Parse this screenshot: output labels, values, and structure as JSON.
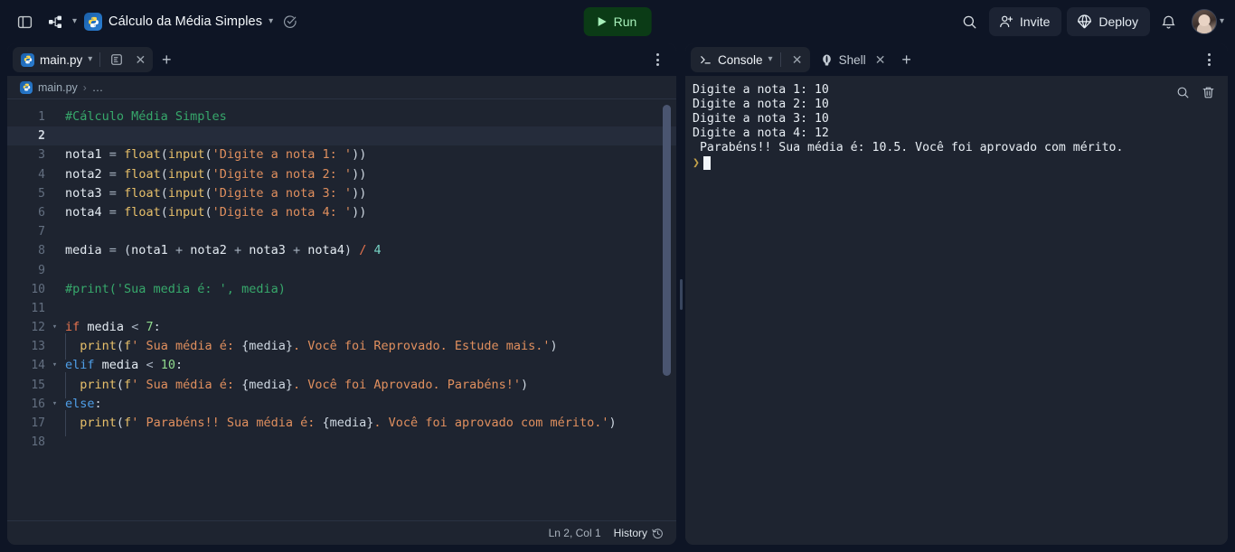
{
  "header": {
    "sidebar_toggle_icon": "panel-left-icon",
    "workflow_icon": "git-branch-icon",
    "project_icon": "python-logo-icon",
    "project_title": "Cálculo da Média Simples",
    "project_chevron": "chevron-down-icon",
    "check_icon": "circle-check-icon",
    "run_label": "Run",
    "run_icon": "play-icon",
    "search_icon": "search-icon",
    "invite_label": "Invite",
    "invite_icon": "user-plus-icon",
    "deploy_label": "Deploy",
    "deploy_icon": "parachute-icon",
    "bell_icon": "bell-icon",
    "avatar_icon": "user-avatar",
    "avatar_chevron": "chevron-down-icon"
  },
  "editor": {
    "tab_label": "main.py",
    "tab_icon": "python-logo-icon",
    "tab_chevron": "chevron-down-icon",
    "preview_icon": "document-pane-icon",
    "close_icon": "close-icon",
    "add_tab_icon": "plus-icon",
    "kebab_icon": "more-options-icon",
    "breadcrumb_file": "main.py",
    "breadcrumb_sep": "›",
    "breadcrumb_tail": "…",
    "status": {
      "cursor_position": "Ln 2, Col 1",
      "history_label": "History",
      "history_icon": "history-clock-icon"
    },
    "lines": [
      {
        "n": "1",
        "fold": "",
        "tokens": [
          {
            "t": "#Cálculo Média Simples",
            "c": "tk-com"
          }
        ]
      },
      {
        "n": "2",
        "fold": "",
        "highlight": true,
        "tokens": []
      },
      {
        "n": "3",
        "fold": "",
        "tokens": [
          {
            "t": "nota1",
            "c": "tk-id"
          },
          {
            "t": " ",
            "c": "tk-op"
          },
          {
            "t": "=",
            "c": "tk-op"
          },
          {
            "t": " ",
            "c": "tk-op"
          },
          {
            "t": "float",
            "c": "tk-fn"
          },
          {
            "t": "(",
            "c": "tk-br"
          },
          {
            "t": "input",
            "c": "tk-fn"
          },
          {
            "t": "(",
            "c": "tk-br"
          },
          {
            "t": "'Digite a nota 1: '",
            "c": "tk-str"
          },
          {
            "t": "))",
            "c": "tk-br"
          }
        ]
      },
      {
        "n": "4",
        "fold": "",
        "tokens": [
          {
            "t": "nota2",
            "c": "tk-id"
          },
          {
            "t": " ",
            "c": "tk-op"
          },
          {
            "t": "=",
            "c": "tk-op"
          },
          {
            "t": " ",
            "c": "tk-op"
          },
          {
            "t": "float",
            "c": "tk-fn"
          },
          {
            "t": "(",
            "c": "tk-br"
          },
          {
            "t": "input",
            "c": "tk-fn"
          },
          {
            "t": "(",
            "c": "tk-br"
          },
          {
            "t": "'Digite a nota 2: '",
            "c": "tk-str"
          },
          {
            "t": "))",
            "c": "tk-br"
          }
        ]
      },
      {
        "n": "5",
        "fold": "",
        "tokens": [
          {
            "t": "nota3",
            "c": "tk-id"
          },
          {
            "t": " ",
            "c": "tk-op"
          },
          {
            "t": "=",
            "c": "tk-op"
          },
          {
            "t": " ",
            "c": "tk-op"
          },
          {
            "t": "float",
            "c": "tk-fn"
          },
          {
            "t": "(",
            "c": "tk-br"
          },
          {
            "t": "input",
            "c": "tk-fn"
          },
          {
            "t": "(",
            "c": "tk-br"
          },
          {
            "t": "'Digite a nota 3: '",
            "c": "tk-str"
          },
          {
            "t": "))",
            "c": "tk-br"
          }
        ]
      },
      {
        "n": "6",
        "fold": "",
        "tokens": [
          {
            "t": "nota4",
            "c": "tk-id"
          },
          {
            "t": " ",
            "c": "tk-op"
          },
          {
            "t": "=",
            "c": "tk-op"
          },
          {
            "t": " ",
            "c": "tk-op"
          },
          {
            "t": "float",
            "c": "tk-fn"
          },
          {
            "t": "(",
            "c": "tk-br"
          },
          {
            "t": "input",
            "c": "tk-fn"
          },
          {
            "t": "(",
            "c": "tk-br"
          },
          {
            "t": "'Digite a nota 4: '",
            "c": "tk-str"
          },
          {
            "t": "))",
            "c": "tk-br"
          }
        ]
      },
      {
        "n": "7",
        "fold": "",
        "tokens": []
      },
      {
        "n": "8",
        "fold": "",
        "tokens": [
          {
            "t": "media",
            "c": "tk-id"
          },
          {
            "t": " = ",
            "c": "tk-op"
          },
          {
            "t": "(",
            "c": "tk-br"
          },
          {
            "t": "nota1",
            "c": "tk-id"
          },
          {
            "t": " + ",
            "c": "tk-op"
          },
          {
            "t": "nota2",
            "c": "tk-id"
          },
          {
            "t": " + ",
            "c": "tk-op"
          },
          {
            "t": "nota3",
            "c": "tk-id"
          },
          {
            "t": " + ",
            "c": "tk-op"
          },
          {
            "t": "nota4",
            "c": "tk-id"
          },
          {
            "t": ")",
            "c": "tk-br"
          },
          {
            "t": " ",
            "c": "tk-op"
          },
          {
            "t": "/",
            "c": "tk-kw"
          },
          {
            "t": " ",
            "c": "tk-op"
          },
          {
            "t": "4",
            "c": "tk-num"
          }
        ]
      },
      {
        "n": "9",
        "fold": "",
        "tokens": []
      },
      {
        "n": "10",
        "fold": "",
        "tokens": [
          {
            "t": "#print('Sua media é: ', media)",
            "c": "tk-com"
          }
        ]
      },
      {
        "n": "11",
        "fold": "",
        "tokens": []
      },
      {
        "n": "12",
        "fold": "v",
        "tokens": [
          {
            "t": "if",
            "c": "tk-kw"
          },
          {
            "t": " ",
            "c": "tk-op"
          },
          {
            "t": "media",
            "c": "tk-id"
          },
          {
            "t": " ",
            "c": "tk-op"
          },
          {
            "t": "<",
            "c": "tk-op"
          },
          {
            "t": " ",
            "c": "tk-op"
          },
          {
            "t": "7",
            "c": "tk-num2"
          },
          {
            "t": ":",
            "c": "tk-br"
          }
        ]
      },
      {
        "n": "13",
        "fold": "",
        "indent": 1,
        "tokens": [
          {
            "t": "print",
            "c": "tk-pre"
          },
          {
            "t": "(",
            "c": "tk-br"
          },
          {
            "t": "f",
            "c": "tk-pre"
          },
          {
            "t": "' Sua média é: ",
            "c": "tk-str"
          },
          {
            "t": "{media}",
            "c": "tk-br"
          },
          {
            "t": ". Você foi Reprovado. Estude mais.'",
            "c": "tk-str"
          },
          {
            "t": ")",
            "c": "tk-br"
          }
        ]
      },
      {
        "n": "14",
        "fold": "v",
        "tokens": [
          {
            "t": "elif",
            "c": "tk-kw2"
          },
          {
            "t": " ",
            "c": "tk-op"
          },
          {
            "t": "media",
            "c": "tk-id"
          },
          {
            "t": " ",
            "c": "tk-op"
          },
          {
            "t": "<",
            "c": "tk-op"
          },
          {
            "t": " ",
            "c": "tk-op"
          },
          {
            "t": "10",
            "c": "tk-num2"
          },
          {
            "t": ":",
            "c": "tk-br"
          }
        ]
      },
      {
        "n": "15",
        "fold": "",
        "indent": 1,
        "tokens": [
          {
            "t": "print",
            "c": "tk-pre"
          },
          {
            "t": "(",
            "c": "tk-br"
          },
          {
            "t": "f",
            "c": "tk-pre"
          },
          {
            "t": "' Sua média é: ",
            "c": "tk-str"
          },
          {
            "t": "{media}",
            "c": "tk-br"
          },
          {
            "t": ". Você foi Aprovado. Parabéns!'",
            "c": "tk-str"
          },
          {
            "t": ")",
            "c": "tk-br"
          }
        ]
      },
      {
        "n": "16",
        "fold": "v",
        "tokens": [
          {
            "t": "else",
            "c": "tk-kw2"
          },
          {
            "t": ":",
            "c": "tk-br"
          }
        ]
      },
      {
        "n": "17",
        "fold": "",
        "indent": 1,
        "tokens": [
          {
            "t": "print",
            "c": "tk-pre"
          },
          {
            "t": "(",
            "c": "tk-br"
          },
          {
            "t": "f",
            "c": "tk-pre"
          },
          {
            "t": "' Parabéns!! Sua média é: ",
            "c": "tk-str"
          },
          {
            "t": "{media}",
            "c": "tk-br"
          },
          {
            "t": ". Você foi aprovado com mérito.'",
            "c": "tk-str"
          },
          {
            "t": ")",
            "c": "tk-br"
          }
        ]
      },
      {
        "n": "18",
        "fold": "",
        "tokens": []
      }
    ]
  },
  "console": {
    "tabs": [
      {
        "label": "Console",
        "icon": "terminal-prompt-icon",
        "active": true
      },
      {
        "label": "Shell",
        "icon": "shell-icon",
        "active": false
      }
    ],
    "tab_chevron": "chevron-down-icon",
    "close_icon": "close-icon",
    "add_tab_icon": "plus-icon",
    "kebab_icon": "more-options-icon",
    "search_icon": "search-icon",
    "clear_icon": "trash-icon",
    "output": "Digite a nota 1: 10\nDigite a nota 2: 10\nDigite a nota 3: 10\nDigite a nota 4: 12\n Parabéns!! Sua média é: 10.5. Você foi aprovado com mérito.",
    "prompt_symbol": "❯"
  },
  "colors": {
    "page_bg": "#0e1525",
    "pane_bg": "#1e2430",
    "run_green": "#0b3b16",
    "run_text": "#a7f0ba",
    "accent_blue": "#2b7fd4"
  }
}
